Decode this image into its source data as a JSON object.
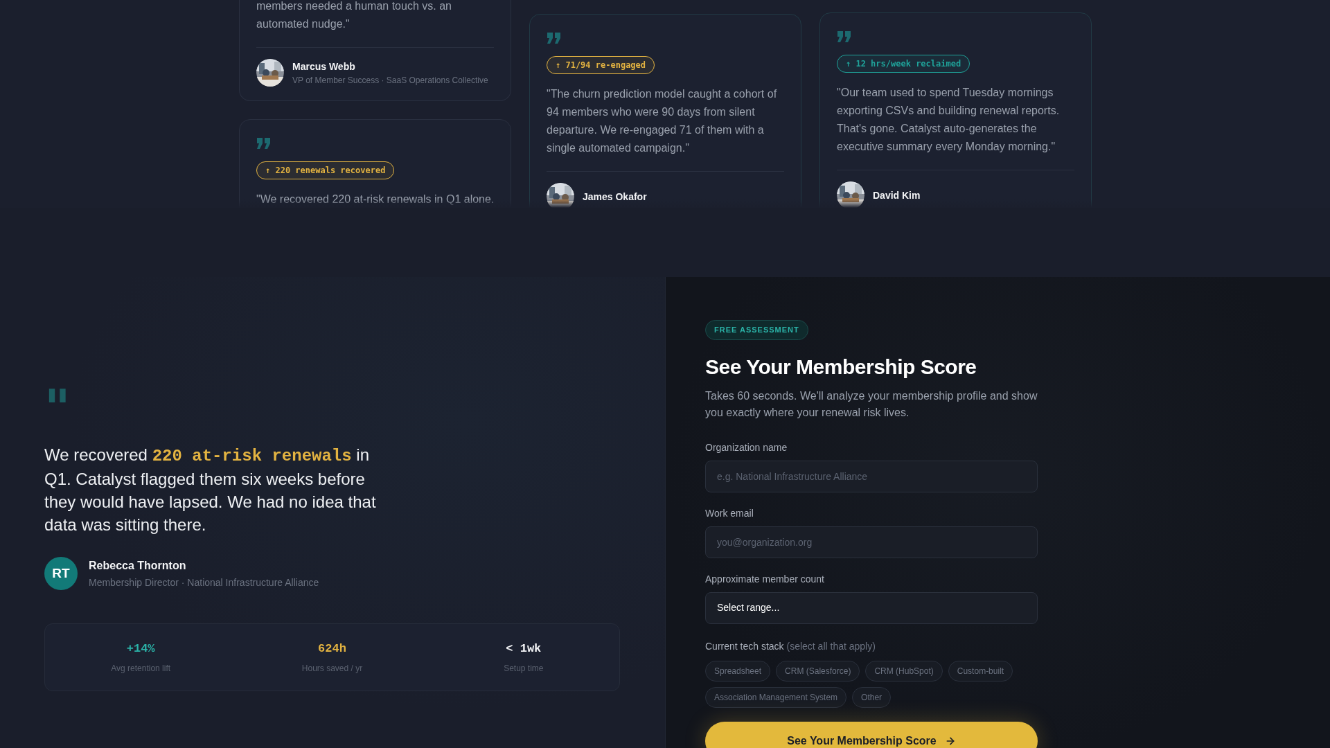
{
  "testimonial_columns": [
    [
      {
        "kind": "continued",
        "quote_lines": [
          "members needed a human touch vs. an",
          "automated nudge.\""
        ],
        "name": "Marcus Webb",
        "role": "VP of Member Success · SaaS Operations Collective"
      },
      {
        "kind": "full",
        "badge": {
          "text": "↑ 220 renewals recovered",
          "color": "#e3b341"
        },
        "quote_lines": [
          "\"We recovered 220 at-risk renewals in Q1 alone."
        ]
      }
    ],
    [
      {
        "kind": "full",
        "badge": {
          "text": "↑ 71/94 re-engaged",
          "color": "#e3b341"
        },
        "quote_lines": [
          "\"The churn prediction model caught a cohort of",
          "94 members who were 90 days from silent",
          "departure. We re-engaged 71 of them with a",
          "single automated campaign.\""
        ],
        "name": "James Okafor"
      }
    ],
    [
      {
        "kind": "full",
        "badge": {
          "text": "↑ 12 hrs/week reclaimed",
          "color": "#1fa39a"
        },
        "quote_lines": [
          "\"Our team used to spend Tuesday mornings",
          "exporting CSVs and building renewal reports.",
          "That's gone. Catalyst auto-generates the",
          "executive summary every Monday morning.\""
        ],
        "name": "David Kim"
      }
    ]
  ],
  "featured": {
    "quote_mark": "\"",
    "quote_before": "We recovered ",
    "quote_highlight": "220 at-risk renewals",
    "quote_after": " in Q1. Catalyst flagged them six weeks before they would have lapsed. We had no idea that data was sitting there.",
    "initials": "RT",
    "name": "Rebecca Thornton",
    "role": "Membership Director · National Infrastructure Alliance",
    "stats": [
      {
        "value": "+14%",
        "label": "Avg retention lift",
        "color": "#2bb3a8"
      },
      {
        "value": "624h",
        "label": "Hours saved / yr",
        "color": "#e3b341"
      },
      {
        "value": "< 1wk",
        "label": "Setup time",
        "color": "#f3f4f6"
      }
    ]
  },
  "form": {
    "badge": "FREE ASSESSMENT",
    "title": "See Your Membership Score",
    "description": "Takes 60 seconds. We'll analyze your membership profile and show you exactly where your renewal risk lives.",
    "fields": [
      {
        "kind": "input",
        "label": "Organization name",
        "placeholder": "e.g. National Infrastructure Alliance"
      },
      {
        "kind": "input",
        "label": "Work email",
        "placeholder": "you@organization.org"
      },
      {
        "kind": "select",
        "label": "Approximate member count",
        "value": "Select range..."
      }
    ],
    "tech_stack": {
      "label": "Current tech stack",
      "hint": "(select all that apply)",
      "options": [
        "Spreadsheet",
        "CRM (Salesforce)",
        "CRM (HubSpot)",
        "Custom-built",
        "Association Management System",
        "Other"
      ]
    },
    "submit": "See Your Membership Score"
  }
}
